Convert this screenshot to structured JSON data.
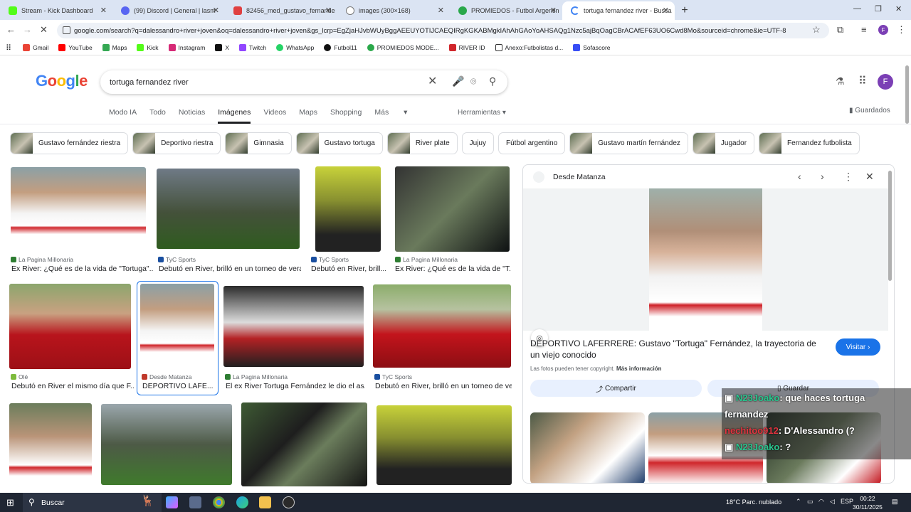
{
  "browser": {
    "tabs": [
      {
        "label": "Stream - Kick Dashboard",
        "color": "#53fc18"
      },
      {
        "label": "(99) Discord | General | lasm",
        "color": "#5865f2"
      },
      {
        "label": "82456_med_gustavo_fernande",
        "color": "#e04040"
      },
      {
        "label": "images (300×168)",
        "color": "#777777"
      },
      {
        "label": "PROMIEDOS - Futbol Argentin",
        "color": "#2aa84a"
      },
      {
        "label": "tortuga fernandez river - Busca",
        "color": "#4285f4"
      }
    ],
    "url": "google.com/search?q=dalessandro+river+joven&oq=dalessandro+river+joven&gs_lcrp=EgZjaHJvbWUyBggAEEUYOTIJCAEQIRgKGKABMgkIAhAhGAoYoAHSAQg1Nzc5ajBqOagCBrACAfEF63UO6Cwd8Mo&sourceid=chrome&ie=UTF-8",
    "bookmarks": [
      {
        "label": "Gmail",
        "color": "#ea4335"
      },
      {
        "label": "YouTube",
        "color": "#ff0000"
      },
      {
        "label": "Maps",
        "color": "#34a853"
      },
      {
        "label": "Kick",
        "color": "#53fc18"
      },
      {
        "label": "Instagram",
        "color": "#d62976"
      },
      {
        "label": "X",
        "color": "#111111"
      },
      {
        "label": "Twitch",
        "color": "#9146ff"
      },
      {
        "label": "WhatsApp",
        "color": "#25d366"
      },
      {
        "label": "Futbol11",
        "color": "#111111"
      },
      {
        "label": "PROMIEDOS MODE...",
        "color": "#2aa84a"
      },
      {
        "label": "RIVER ID",
        "color": "#d0262b"
      },
      {
        "label": "Anexo:Futbolistas d...",
        "color": "#333333"
      },
      {
        "label": "Sofascore",
        "color": "#374df5"
      }
    ]
  },
  "google": {
    "logo": "Google",
    "query": "tortuga fernandez river",
    "avatar_letter": "F",
    "nav": [
      "Modo IA",
      "Todo",
      "Noticias",
      "Imágenes",
      "Videos",
      "Maps",
      "Shopping",
      "Más"
    ],
    "tools": "Herramientas",
    "saved": "Guardados",
    "chips": [
      "Gustavo fernández riestra",
      "Deportivo riestra",
      "Gimnasia",
      "Gustavo tortuga",
      "River plate",
      "Jujuy",
      "Fútbol argentino",
      "Gustavo martín fernández",
      "Jugador",
      "Fernandez futbolista"
    ]
  },
  "results": [
    {
      "source": "La Pagina Millonaria",
      "title": "Ex River: ¿Qué es de la vida de \"Tortuga\"..."
    },
    {
      "source": "TyC Sports",
      "title": "Debutó en River, brilló en un torneo de vera..."
    },
    {
      "source": "TyC Sports",
      "title": "Debutó en River, brill..."
    },
    {
      "source": "La Pagina Millonaria",
      "title": "Ex River: ¿Qué es de la vida de \"T..."
    },
    {
      "source": "Olé",
      "title": "Debutó en River el mismo día que F..."
    },
    {
      "source": "Desde Matanza",
      "title": "DEPORTIVO LAFE..."
    },
    {
      "source": "La Pagina Millonaria",
      "title": "El ex River Tortuga Fernández le dio el as..."
    },
    {
      "source": "TyC Sports",
      "title": "Debutó en River, brilló en un torneo de ve..."
    }
  ],
  "panel": {
    "source": "Desde Matanza",
    "title": "DEPORTIVO LAFERRERE: Gustavo \"Tortuga\" Fernández, la trayectoria de un viejo conocido",
    "visit": "Visitar",
    "copyright": "Las fotos pueden tener copyright.",
    "more_info": "Más información",
    "share": "Compartir",
    "save": "Guardar"
  },
  "chat": [
    {
      "user": "N23Joako",
      "text": ": que haces tortuga fernandez"
    },
    {
      "user": "nechitoo912",
      "text": ": D'Alessandro (?"
    },
    {
      "user": "N23Joako",
      "text": ": ?"
    }
  ],
  "taskbar": {
    "search": "Buscar",
    "weather": "18°C  Parc. nublado",
    "lang": "ESP",
    "time": "00:22",
    "date": "30/11/2025"
  }
}
